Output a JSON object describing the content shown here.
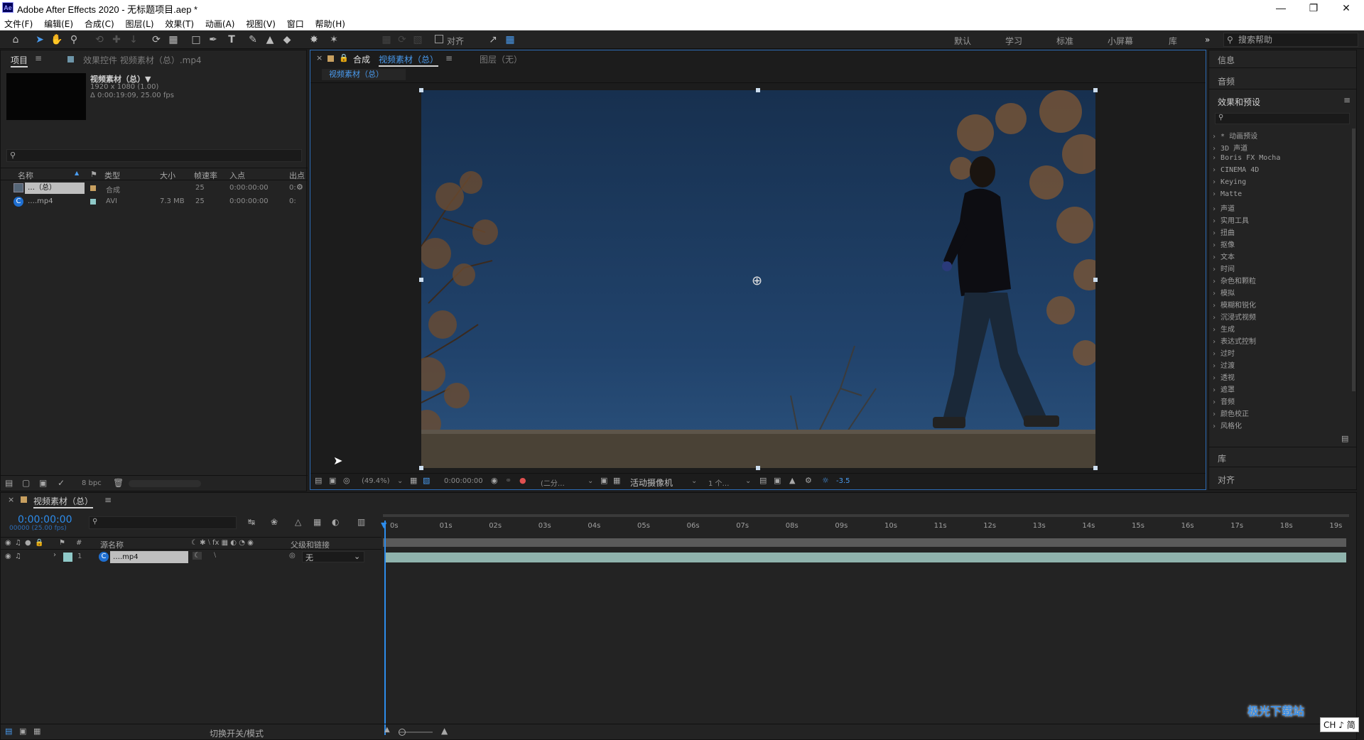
{
  "window": {
    "title": "Adobe After Effects 2020 - 无标题项目.aep *",
    "app_icon": "Ae"
  },
  "menu": [
    "文件(F)",
    "编辑(E)",
    "合成(C)",
    "图层(L)",
    "效果(T)",
    "动画(A)",
    "视图(V)",
    "窗口",
    "帮助(H)"
  ],
  "toolbar": {
    "snap_label": "对齐",
    "workspaces": [
      "默认",
      "学习",
      "标准",
      "小屏幕",
      "库"
    ],
    "more": "»",
    "help_search_placeholder": "搜索帮助"
  },
  "project_panel": {
    "tab_project": "项目",
    "tab_effects": "效果控件 视频素材（总）.mp4",
    "preview_name": "视频素材（总）▼",
    "preview_info1": "1920 x 1080 (1.00)",
    "preview_info2": "Δ 0:00:19:09, 25.00 fps",
    "search_placeholder": "",
    "columns": [
      "名称",
      "类型",
      "大小",
      "帧速率",
      "入点",
      "出点"
    ],
    "rows": [
      {
        "name": "…（总）",
        "type": "合成",
        "size": "",
        "fps": "25",
        "in": "0:00:00:00",
        "out": "0:"
      },
      {
        "name": "….mp4",
        "type": "AVI",
        "size": "7.3 MB",
        "fps": "25",
        "in": "0:00:00:00",
        "out": "0:"
      }
    ],
    "bpc": "8 bpc"
  },
  "comp_panel": {
    "tab_comp_prefix": "合成",
    "tab_comp_name": "视频素材（总）",
    "tab_layer": "图层（无）",
    "sub_tab": "视频素材（总）",
    "zoom": "(49.4%)",
    "timecode": "0:00:00:00",
    "resolution": "(二分…",
    "camera": "活动摄像机",
    "views": "1 个…",
    "exposure": "-3.5"
  },
  "right_panel": {
    "info": "信息",
    "audio": "音频",
    "effects_presets": "效果和预设",
    "items": [
      "* 动画预设",
      "3D 声道",
      "Boris FX Mocha",
      "CINEMA 4D",
      "Keying",
      "Matte",
      "声道",
      "实用工具",
      "扭曲",
      "抠像",
      "文本",
      "时间",
      "杂色和颗粒",
      "模拟",
      "模糊和锐化",
      "沉浸式视频",
      "生成",
      "表达式控制",
      "过时",
      "过渡",
      "透视",
      "遮罩",
      "音频",
      "颜色校正",
      "风格化"
    ],
    "library": "库",
    "align": "对齐"
  },
  "timeline": {
    "tab": "视频素材（总）",
    "timecode": "0:00:00:00",
    "fps_info": "00000 (25.00 fps)",
    "col_source": "源名称",
    "col_parent": "父级和链接",
    "layer_num": "1",
    "layer_name": "….mp4",
    "parent_value": "无",
    "ruler": [
      "0s",
      "01s",
      "02s",
      "03s",
      "04s",
      "05s",
      "06s",
      "07s",
      "08s",
      "09s",
      "10s",
      "11s",
      "12s",
      "13s",
      "14s",
      "15s",
      "16s",
      "17s",
      "18s",
      "19s"
    ],
    "toggle_label": "切换开关/模式"
  },
  "watermark": {
    "text": "极光下载站",
    "ime": "CH ♪ 简"
  },
  "colors": {
    "accent_blue": "#2d8ceb",
    "panel_bg": "#232323",
    "sky": "#1f3a5c",
    "layer_bar": "#8fb3ad"
  }
}
